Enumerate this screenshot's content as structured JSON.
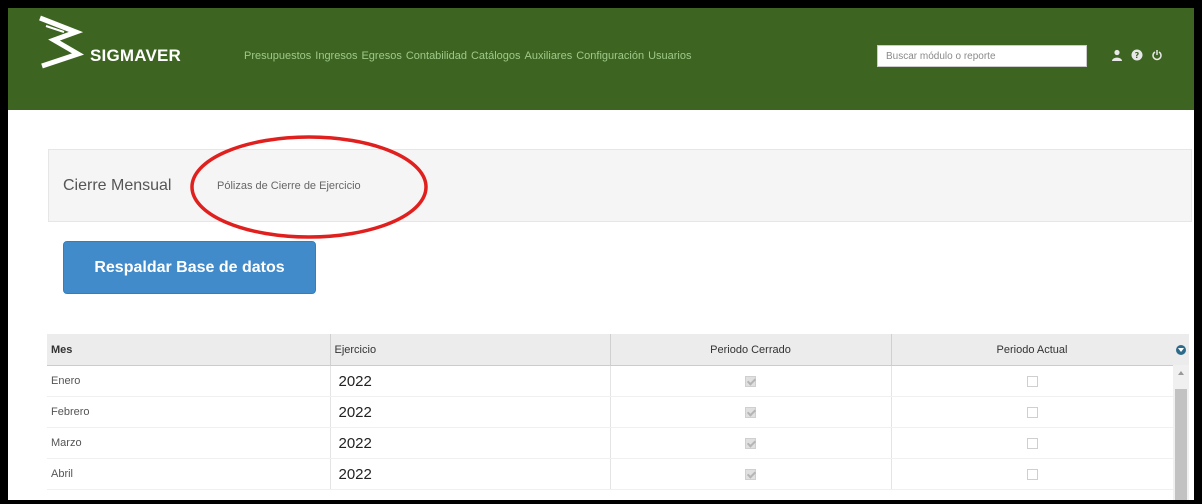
{
  "app": {
    "brand": "SIGMAVER"
  },
  "nav": {
    "items": [
      "Presupuestos",
      "Ingresos",
      "Egresos",
      "Contabilidad",
      "Catálogos",
      "Auxiliares",
      "Configuración",
      "Usuarios"
    ],
    "search_placeholder": "Buscar módulo o reporte",
    "icons": [
      "user-icon",
      "help-icon",
      "logout-icon"
    ]
  },
  "breadcrumb": {
    "first": "Cierre Mensual",
    "second": "Pólizas de Cierre de Ejercicio"
  },
  "actions": {
    "backup_label": "Respaldar Base de datos"
  },
  "table": {
    "columns": [
      "Mes",
      "Ejercicio",
      "Periodo Cerrado",
      "Periodo Actual"
    ],
    "rows": [
      {
        "mes": "Enero",
        "ejercicio": "2022",
        "cerrado": true,
        "actual": false
      },
      {
        "mes": "Febrero",
        "ejercicio": "2022",
        "cerrado": true,
        "actual": false
      },
      {
        "mes": "Marzo",
        "ejercicio": "2022",
        "cerrado": true,
        "actual": false
      },
      {
        "mes": "Abril",
        "ejercicio": "2022",
        "cerrado": true,
        "actual": false
      }
    ]
  },
  "colors": {
    "navbar": "#3d6420",
    "button": "#428bca",
    "highlight": "#e0201e"
  }
}
